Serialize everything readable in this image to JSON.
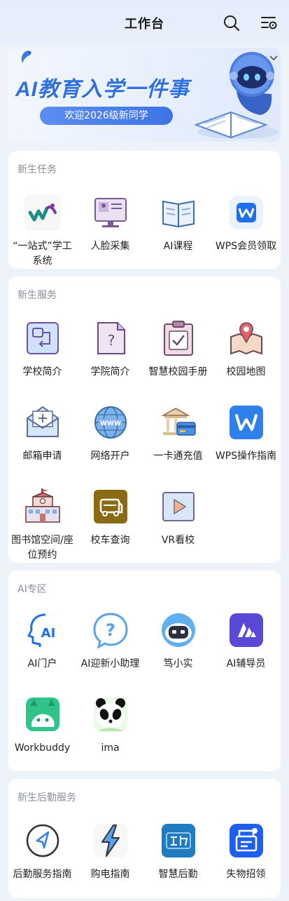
{
  "header": {
    "title": "工作台"
  },
  "banner": {
    "title": "AI教育入学一件事",
    "subtitle": "欢迎2026级新同学"
  },
  "sections": [
    {
      "title": "新生任务",
      "items": [
        {
          "label": "“一站式”学工系统",
          "icon": "yizhanshi-icon"
        },
        {
          "label": "人脸采集",
          "icon": "face-capture-icon"
        },
        {
          "label": "AI课程",
          "icon": "book-icon"
        },
        {
          "label": "WPS会员领取",
          "icon": "wps-icon"
        }
      ]
    },
    {
      "title": "新生服务",
      "items": [
        {
          "label": "学校简介",
          "icon": "school-intro-icon"
        },
        {
          "label": "学院简介",
          "icon": "college-intro-icon"
        },
        {
          "label": "智慧校园手册",
          "icon": "clipboard-icon"
        },
        {
          "label": "校园地图",
          "icon": "map-icon"
        },
        {
          "label": "邮箱申请",
          "icon": "mail-icon"
        },
        {
          "label": "网络开户",
          "icon": "globe-icon"
        },
        {
          "label": "一卡通充值",
          "icon": "bank-card-icon"
        },
        {
          "label": "WPS操作指南",
          "icon": "wps-icon"
        },
        {
          "label": "图书馆空间/座位预约",
          "icon": "library-icon"
        },
        {
          "label": "校车查询",
          "icon": "bus-icon"
        },
        {
          "label": "VR看校",
          "icon": "play-icon"
        }
      ]
    },
    {
      "title": "AI专区",
      "items": [
        {
          "label": "AI门户",
          "icon": "ai-head-icon"
        },
        {
          "label": "AI迎新小助理",
          "icon": "question-bubble-icon"
        },
        {
          "label": "笃小实",
          "icon": "robot-icon"
        },
        {
          "label": "AI辅导员",
          "icon": "ai-counselor-icon"
        },
        {
          "label": "Workbuddy",
          "icon": "workbuddy-icon"
        },
        {
          "label": "ima",
          "icon": "panda-icon"
        }
      ]
    },
    {
      "title": "新生后勤服务",
      "items": [
        {
          "label": "后勤服务指南",
          "icon": "navigation-icon"
        },
        {
          "label": "购电指南",
          "icon": "lightning-icon"
        },
        {
          "label": "智慧后勤",
          "icon": "houqin-icon"
        },
        {
          "label": "失物招领",
          "icon": "lost-found-icon"
        }
      ]
    }
  ],
  "colors": {
    "accent": "#2e6fe2",
    "card": "#ffffff",
    "background": "#eef2f9"
  }
}
